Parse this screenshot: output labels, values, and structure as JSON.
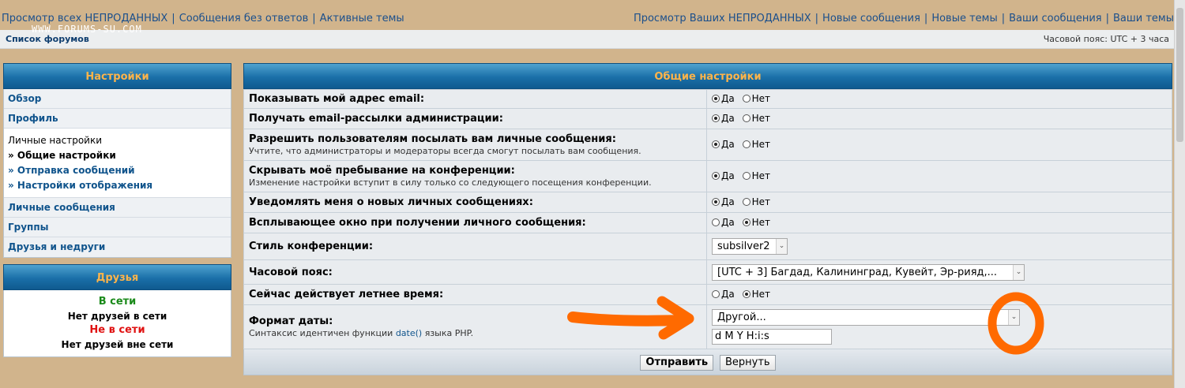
{
  "topnav": {
    "left": [
      "Просмотр всех НЕПРОДАННЫХ",
      "Сообщения без ответов",
      "Активные темы"
    ],
    "right": [
      "Просмотр Ваших НЕПРОДАННЫХ",
      "Новые сообщения",
      "Новые темы",
      "Ваши сообщения",
      "Ваши темы"
    ],
    "watermark": "WWW.FORUMS-SU.COM"
  },
  "crumbbar": {
    "breadcrumb": "Список форумов",
    "timezone": "Часовой пояс: UTC + 3 часа"
  },
  "sidebar": {
    "title": "Настройки",
    "items": [
      "Обзор",
      "Профиль"
    ],
    "personal": {
      "title": "Личные настройки",
      "subs": [
        "» Общие настройки",
        "» Отправка сообщений",
        "» Настройки отображения"
      ]
    },
    "items_after": [
      "Личные сообщения",
      "Группы",
      "Друзья и недруги"
    ],
    "friends": {
      "title": "Друзья",
      "online_label": "В сети",
      "online_none": "Нет друзей в сети",
      "offline_label": "Не в сети",
      "offline_none": "Нет друзей вне сети"
    }
  },
  "main": {
    "title": "Общие настройки",
    "rows": [
      {
        "label": "Показывать мой адрес email:",
        "yes": "Да",
        "no": "Нет",
        "selected": "yes"
      },
      {
        "label": "Получать email-рассылки администрации:",
        "yes": "Да",
        "no": "Нет",
        "selected": "yes"
      },
      {
        "label": "Разрешить пользователям посылать вам личные сообщения:",
        "note": "Учтите, что администраторы и модераторы всегда смогут посылать вам сообщения.",
        "yes": "Да",
        "no": "Нет",
        "selected": "yes"
      },
      {
        "label": "Скрывать моё пребывание на конференции:",
        "note": "Изменение настройки вступит в силу только со следующего посещения конференции.",
        "yes": "Да",
        "no": "Нет",
        "selected": "yes"
      },
      {
        "label": "Уведомлять меня о новых личных сообщениях:",
        "yes": "Да",
        "no": "Нет",
        "selected": "yes"
      },
      {
        "label": "Всплывающее окно при получении личного сообщения:",
        "yes": "Да",
        "no": "Нет",
        "selected": "no"
      }
    ],
    "style": {
      "label": "Стиль конференции:",
      "value": "subsilver2"
    },
    "timezone": {
      "label": "Часовой пояс:",
      "value": "[UTC + 3] Багдад, Калининград, Кувейт, Эр-рияд,..."
    },
    "dst": {
      "label": "Сейчас действует летнее время:",
      "yes": "Да",
      "no": "Нет",
      "selected": "no"
    },
    "dateformat": {
      "label": "Формат даты:",
      "note_before": "Синтаксис идентичен функции ",
      "note_fn": "date()",
      "note_after": " языка PHP.",
      "select_value": "Другой...",
      "input_value": "d M Y H:i:s"
    },
    "submit": "Отправить",
    "reset": "Вернуть"
  },
  "colors": {
    "annotation": "#ff6a00",
    "header_text": "#ffb44a",
    "link": "#10548c"
  }
}
